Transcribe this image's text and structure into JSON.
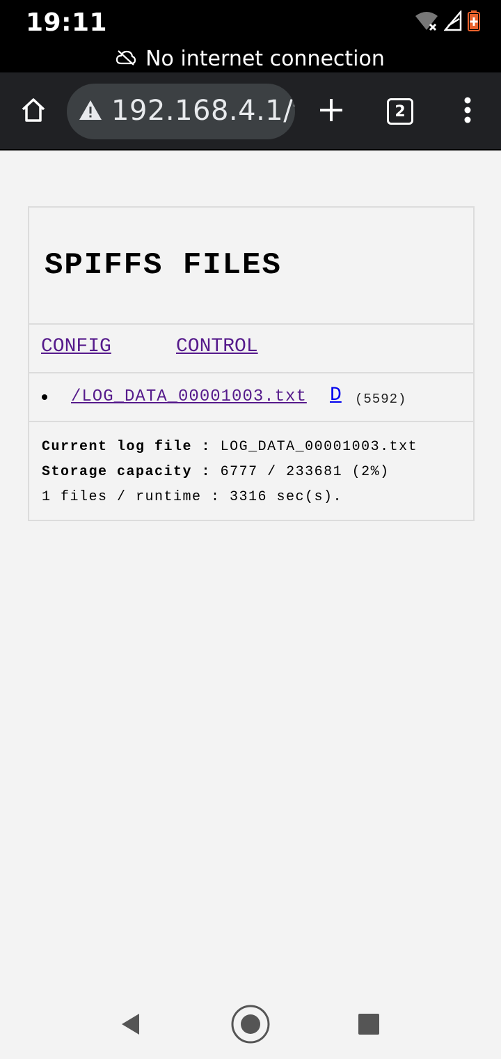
{
  "status_bar": {
    "time": "19:11",
    "icons": [
      "wifi-off-icon",
      "signal-icon",
      "battery-charging-icon"
    ],
    "network_message": "No internet connection"
  },
  "browser": {
    "url": "192.168.4.1/f",
    "tab_count": "2",
    "icons": [
      "home-icon",
      "warning-icon",
      "new-tab-icon",
      "tabs-icon",
      "more-menu-icon"
    ]
  },
  "page": {
    "title": "SPIFFS FILES",
    "nav_links": [
      "CONFIG",
      "CONTROL"
    ],
    "files": [
      {
        "name": "/LOG_DATA_00001003.txt",
        "delete_label": "D",
        "size": "(5592)"
      }
    ],
    "info": {
      "current_log_label": "Current log file :",
      "current_log_value": "LOG_DATA_00001003.txt",
      "storage_label": "Storage capacity :",
      "storage_value": "6777 / 233681 (2%)",
      "summary": "1 files / runtime : 3316 sec(s)."
    }
  },
  "colors": {
    "visited_link": "#551a8b",
    "link": "#0000ee",
    "toolbar_bg": "#202124",
    "page_bg": "#f3f3f3"
  },
  "system_nav": [
    "back-icon",
    "home-circle-icon",
    "recents-icon"
  ]
}
